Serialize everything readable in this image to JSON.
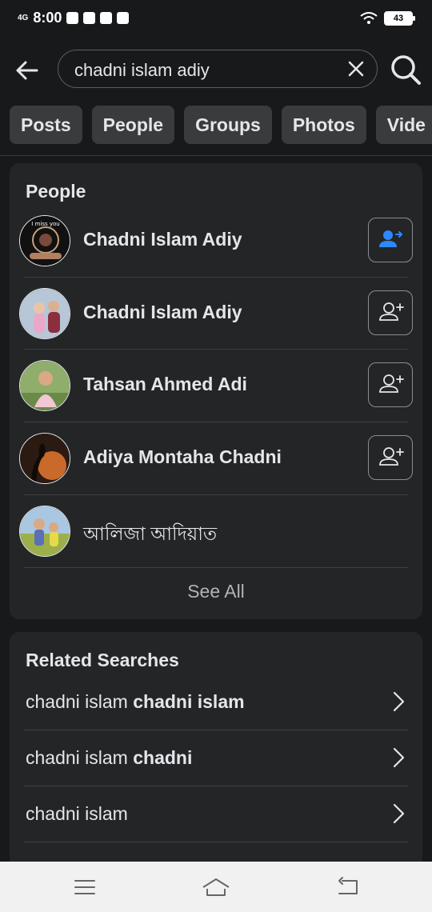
{
  "status_bar": {
    "network": "4G",
    "time": "8:00",
    "battery": "43"
  },
  "search": {
    "query": "chadni islam adiy"
  },
  "filters": [
    {
      "label": "Posts"
    },
    {
      "label": "People"
    },
    {
      "label": "Groups"
    },
    {
      "label": "Photos"
    },
    {
      "label": "Vide"
    }
  ],
  "people_section": {
    "title": "People",
    "people": [
      {
        "name": "Chadni Islam Adiy",
        "action": "friend-request-sent"
      },
      {
        "name": "Chadni Islam Adiy",
        "action": "add-friend"
      },
      {
        "name": "Tahsan Ahmed Adi",
        "action": "add-friend"
      },
      {
        "name": "Adiya Montaha Chadni",
        "action": "add-friend"
      },
      {
        "name": "আলিজা আদিয়াত",
        "action": "none"
      }
    ],
    "see_all": "See All"
  },
  "related_section": {
    "title": "Related Searches",
    "items": [
      {
        "normal": "chadni islam ",
        "bold": "chadni islam"
      },
      {
        "normal": "chadni islam ",
        "bold": "chadni"
      },
      {
        "normal": "chadni islam",
        "bold": ""
      }
    ]
  },
  "icons": {
    "back": "back-arrow-icon",
    "clear": "close-icon",
    "search": "search-icon",
    "friend_sent": "friend-request-sent-icon",
    "add_friend": "add-friend-icon",
    "chevron": "chevron-right-icon",
    "menu": "menu-icon",
    "home": "home-icon",
    "back_nav": "back-nav-icon"
  },
  "colors": {
    "background": "#18191a",
    "card": "#242526",
    "chip": "#3a3b3c",
    "accent": "#2d88ff",
    "text": "#e4e6eb",
    "muted": "#b0b3b8"
  }
}
